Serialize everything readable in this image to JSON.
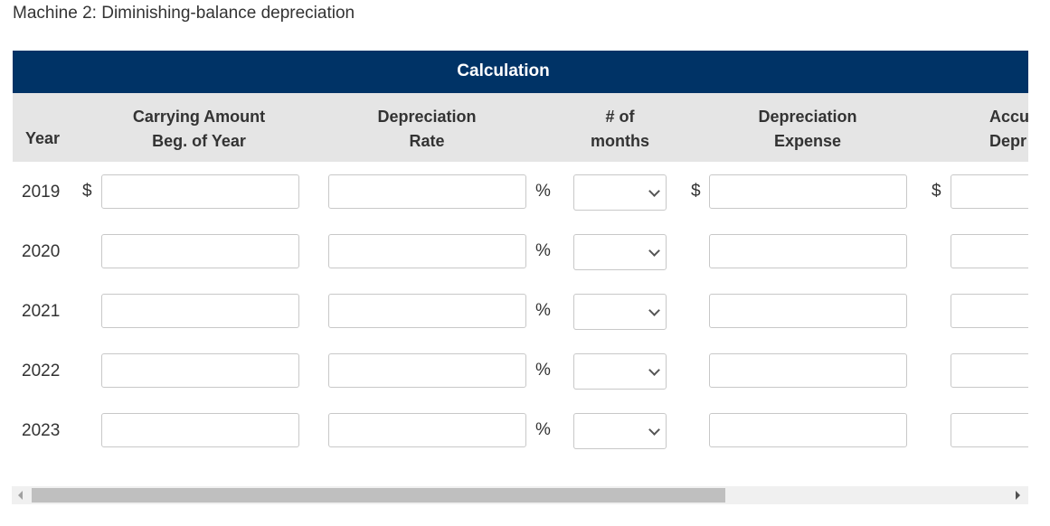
{
  "title": "Machine 2: Diminishing-balance depreciation",
  "table": {
    "band_title": "Calculation",
    "headers": {
      "year": "Year",
      "carrying_amount": [
        "Carrying Amount",
        "Beg. of Year"
      ],
      "depreciation_rate": [
        "Depreciation",
        "Rate"
      ],
      "months": [
        "# of",
        "months"
      ],
      "depreciation_expense": [
        "Depreciation",
        "Expense"
      ],
      "accumulated": [
        "Accu",
        "Depr"
      ]
    },
    "currency_symbol": "$",
    "percent_symbol": "%",
    "rows": [
      {
        "year": "2019",
        "carrying_amount": "",
        "rate": "",
        "months": "",
        "expense": "",
        "accumulated": "",
        "show_currency": true
      },
      {
        "year": "2020",
        "carrying_amount": "",
        "rate": "",
        "months": "",
        "expense": "",
        "accumulated": "",
        "show_currency": false
      },
      {
        "year": "2021",
        "carrying_amount": "",
        "rate": "",
        "months": "",
        "expense": "",
        "accumulated": "",
        "show_currency": false
      },
      {
        "year": "2022",
        "carrying_amount": "",
        "rate": "",
        "months": "",
        "expense": "",
        "accumulated": "",
        "show_currency": false
      },
      {
        "year": "2023",
        "carrying_amount": "",
        "rate": "",
        "months": "",
        "expense": "",
        "accumulated": "",
        "show_currency": false
      }
    ]
  },
  "scrollbar": {
    "position_fraction": 0.0,
    "visible_fraction": 0.71
  }
}
